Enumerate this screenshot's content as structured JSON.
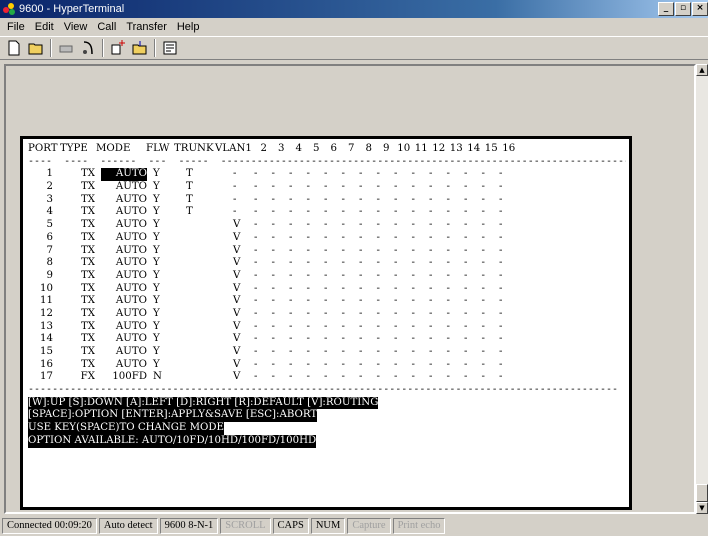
{
  "window": {
    "title": "9600 - HyperTerminal",
    "controls": [
      "_",
      "▫",
      "×"
    ]
  },
  "menu": [
    "File",
    "Edit",
    "View",
    "Call",
    "Transfer",
    "Help"
  ],
  "toolbar": [
    "new-icon",
    "open-icon",
    "disconnect-icon",
    "dial-icon",
    "send-icon",
    "receive-icon",
    "properties-icon"
  ],
  "terminal": {
    "header": {
      "port": "PORT",
      "type": "TYPE",
      "mode": "MODE",
      "flw": "FLW",
      "trunk": "TRUNK",
      "vlan": "VLAN1",
      "cols": [
        "2",
        "3",
        "4",
        "5",
        "6",
        "7",
        "8",
        "9",
        "10",
        "11",
        "12",
        "13",
        "14",
        "15",
        "16"
      ]
    },
    "underline": "----  ----  ------  ---  -----  ---------------------------------------------------------------------",
    "rows": [
      {
        "port": "1",
        "type": "TX",
        "mode": "AUTO",
        "flw": "Y",
        "trunk": "T",
        "vlan": "-"
      },
      {
        "port": "2",
        "type": "TX",
        "mode": "AUTO",
        "flw": "Y",
        "trunk": "T",
        "vlan": "-"
      },
      {
        "port": "3",
        "type": "TX",
        "mode": "AUTO",
        "flw": "Y",
        "trunk": "T",
        "vlan": "-"
      },
      {
        "port": "4",
        "type": "TX",
        "mode": "AUTO",
        "flw": "Y",
        "trunk": "T",
        "vlan": "-"
      },
      {
        "port": "5",
        "type": "TX",
        "mode": "AUTO",
        "flw": "Y",
        "trunk": "",
        "vlan": "V"
      },
      {
        "port": "6",
        "type": "TX",
        "mode": "AUTO",
        "flw": "Y",
        "trunk": "",
        "vlan": "V"
      },
      {
        "port": "7",
        "type": "TX",
        "mode": "AUTO",
        "flw": "Y",
        "trunk": "",
        "vlan": "V"
      },
      {
        "port": "8",
        "type": "TX",
        "mode": "AUTO",
        "flw": "Y",
        "trunk": "",
        "vlan": "V"
      },
      {
        "port": "9",
        "type": "TX",
        "mode": "AUTO",
        "flw": "Y",
        "trunk": "",
        "vlan": "V"
      },
      {
        "port": "10",
        "type": "TX",
        "mode": "AUTO",
        "flw": "Y",
        "trunk": "",
        "vlan": "V"
      },
      {
        "port": "11",
        "type": "TX",
        "mode": "AUTO",
        "flw": "Y",
        "trunk": "",
        "vlan": "V"
      },
      {
        "port": "12",
        "type": "TX",
        "mode": "AUTO",
        "flw": "Y",
        "trunk": "",
        "vlan": "V"
      },
      {
        "port": "13",
        "type": "TX",
        "mode": "AUTO",
        "flw": "Y",
        "trunk": "",
        "vlan": "V"
      },
      {
        "port": "14",
        "type": "TX",
        "mode": "AUTO",
        "flw": "Y",
        "trunk": "",
        "vlan": "V"
      },
      {
        "port": "15",
        "type": "TX",
        "mode": "AUTO",
        "flw": "Y",
        "trunk": "",
        "vlan": "V"
      },
      {
        "port": "16",
        "type": "TX",
        "mode": "AUTO",
        "flw": "Y",
        "trunk": "",
        "vlan": "V"
      },
      {
        "port": "17",
        "type": "FX",
        "mode": "100FD",
        "flw": "N",
        "trunk": "",
        "vlan": "V"
      }
    ],
    "cell_placeholder": "-",
    "selected_row": 0,
    "footer_divider": "--------------------------------------------------------------------------------------------------",
    "help1": "[W]:UP [S]:DOWN [A]:LEFT [D]:RIGHT [R]:DEFAULT [V]:ROUTING",
    "help2": "[SPACE]:OPTION [ENTER]:APPLY&SAVE [ESC]:ABORT",
    "help3": "USE KEY(SPACE)TO CHANGE MODE",
    "help4": "OPTION AVAILABLE: AUTO/10FD/10HD/100FD/100HD"
  },
  "status": {
    "connected": "Connected 00:09:20",
    "detect": "Auto detect",
    "settings": "9600 8-N-1",
    "scroll": "SCROLL",
    "caps": "CAPS",
    "num": "NUM",
    "capture": "Capture",
    "print": "Print echo"
  }
}
